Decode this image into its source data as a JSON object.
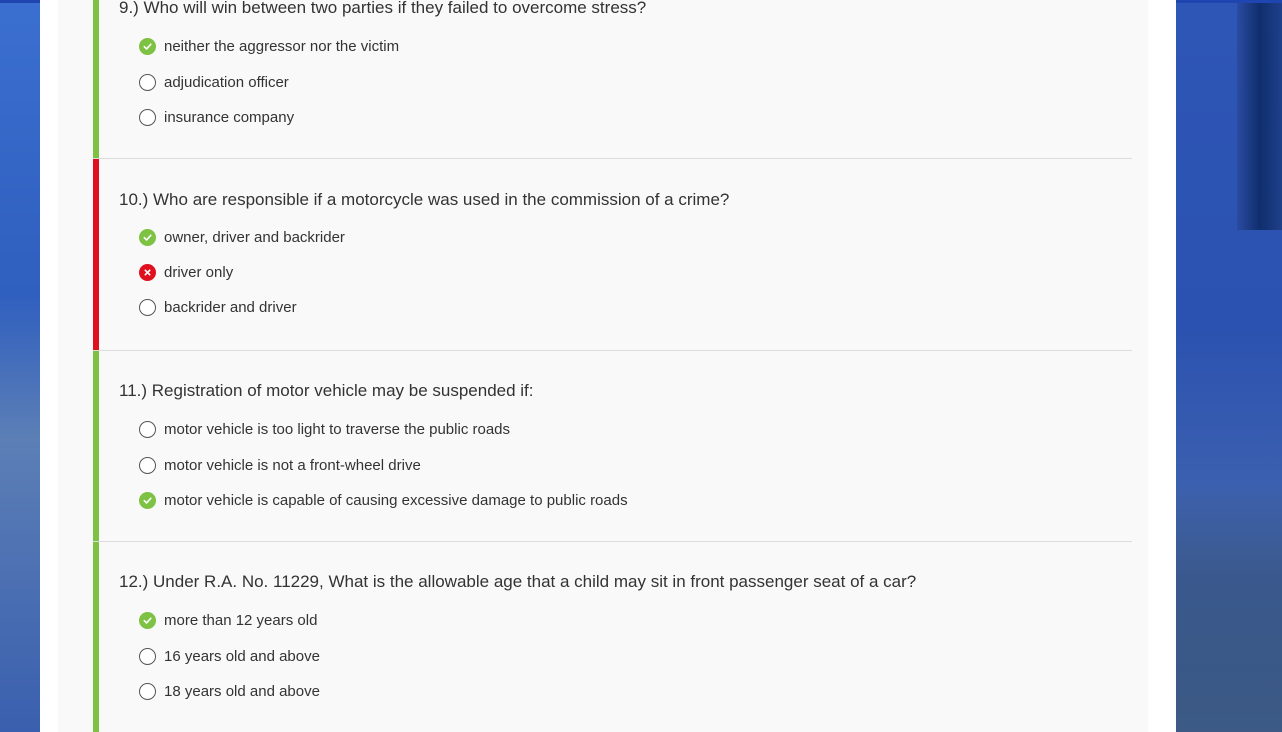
{
  "colors": {
    "correct": "#7dc242",
    "incorrect": "#e0111f",
    "page_background": "#2f58b8"
  },
  "questions": [
    {
      "text": "9.) Who will win between two parties if they failed to overcome stress?",
      "status": "correct",
      "options": [
        {
          "label": "neither the aggressor nor the victim",
          "state": "correct"
        },
        {
          "label": "adjudication officer",
          "state": "empty"
        },
        {
          "label": "insurance company",
          "state": "empty"
        }
      ]
    },
    {
      "text": "10.) Who are responsible if a motorcycle was used in the commission of a crime?",
      "status": "incorrect",
      "options": [
        {
          "label": "owner, driver and backrider",
          "state": "correct"
        },
        {
          "label": "driver only",
          "state": "wrong"
        },
        {
          "label": "backrider and driver",
          "state": "empty"
        }
      ]
    },
    {
      "text": "11.) Registration of motor vehicle may be suspended if:",
      "status": "correct",
      "options": [
        {
          "label": "motor vehicle is too light to traverse the public roads",
          "state": "empty"
        },
        {
          "label": "motor vehicle is not a front-wheel drive",
          "state": "empty"
        },
        {
          "label": "motor vehicle is capable of causing excessive damage to public roads",
          "state": "correct"
        }
      ]
    },
    {
      "text": "12.) Under R.A. No. 11229, What is the allowable age that a child may sit in front passenger seat of a car?",
      "status": "correct",
      "options": [
        {
          "label": "more than 12 years old",
          "state": "correct"
        },
        {
          "label": "16 years old and above",
          "state": "empty"
        },
        {
          "label": "18 years old and above",
          "state": "empty"
        }
      ]
    }
  ]
}
